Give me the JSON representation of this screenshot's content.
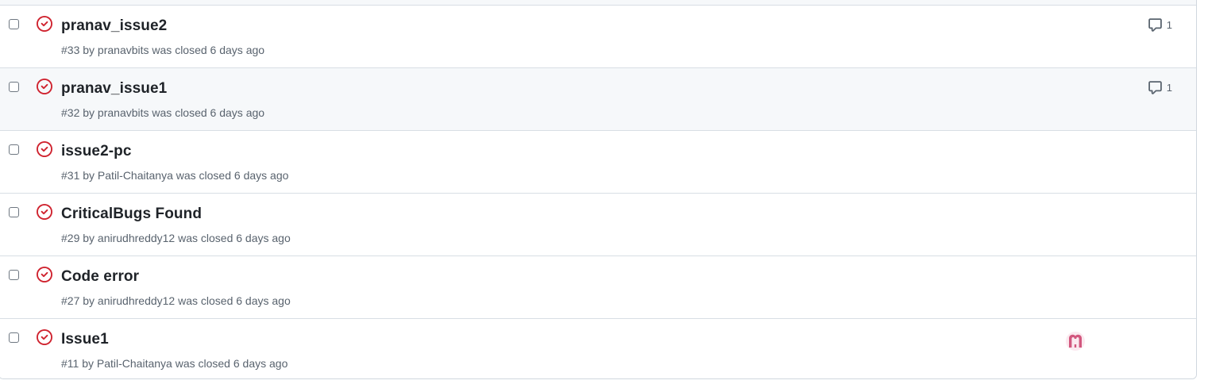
{
  "colors": {
    "closed_icon": "#cf222e",
    "meta_text": "#59636e",
    "hover_row": "#f6f8fa",
    "border": "#d0d7de"
  },
  "icons": {
    "state": "issue-closed-icon",
    "comment": "comment-icon"
  },
  "issues": [
    {
      "title": "pranav_issue2",
      "meta": "#33 by pranavbits was closed 6 days ago",
      "comments": "1"
    },
    {
      "title": "pranav_issue1",
      "meta": "#32 by pranavbits was closed 6 days ago",
      "comments": "1"
    },
    {
      "title": "issue2-pc",
      "meta": "#31 by Patil-Chaitanya was closed 6 days ago"
    },
    {
      "title": "CriticalBugs Found",
      "meta": "#29 by anirudhreddy12 was closed 6 days ago"
    },
    {
      "title": "Code error",
      "meta": "#27 by anirudhreddy12 was closed 6 days ago"
    },
    {
      "title": "Issue1",
      "meta": "#11 by Patil-Chaitanya was closed 6 days ago",
      "assignee_avatar": "assignee-avatar"
    }
  ]
}
